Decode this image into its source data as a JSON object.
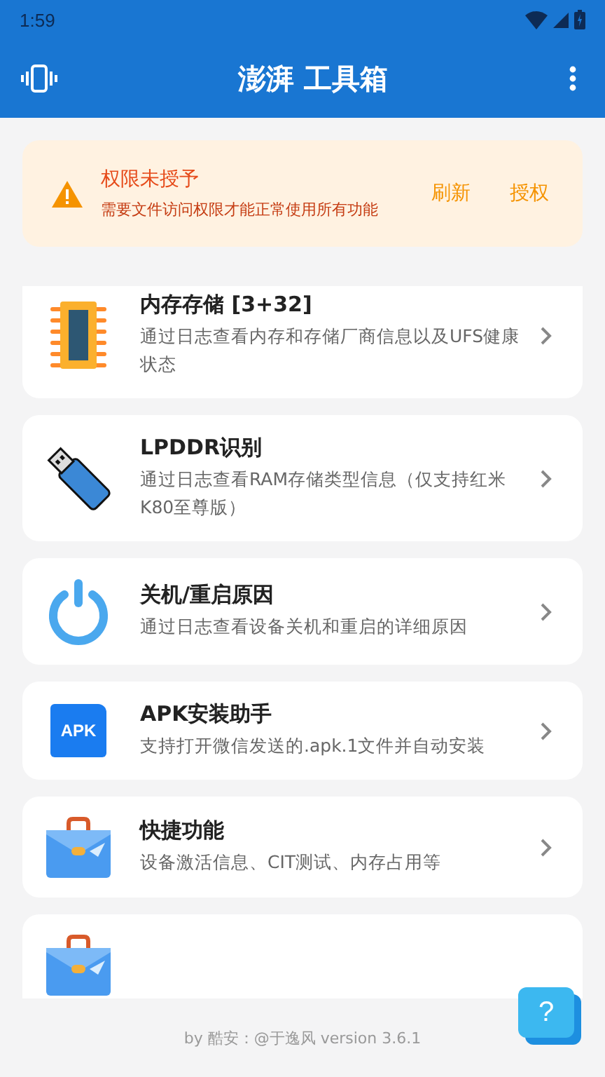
{
  "status_bar": {
    "time": "1:59"
  },
  "app_bar": {
    "title": "澎湃 工具箱"
  },
  "permission_banner": {
    "title": "权限未授予",
    "message": "需要文件访问权限才能正常使用所有功能",
    "actions": [
      "刷新",
      "授权"
    ]
  },
  "tools": [
    {
      "kind": "ram",
      "title": "内存存储 [3+32]",
      "description": "通过日志查看内存和存储厂商信息以及UFS健康状态"
    },
    {
      "kind": "usb",
      "title": "LPDDR识别",
      "description": "通过日志查看RAM存储类型信息（仅支持红米K80至尊版）"
    },
    {
      "kind": "power",
      "title": "关机/重启原因",
      "description": "通过日志查看设备关机和重启的详细原因"
    },
    {
      "kind": "apk",
      "title": "APK安装助手",
      "description": "支持打开微信发送的.apk.1文件并自动安装",
      "icon_text": "APK"
    },
    {
      "kind": "briefcase",
      "title": "快捷功能",
      "description": "设备激活信息、CIT测试、内存占用等"
    },
    {
      "kind": "briefcase"
    }
  ],
  "footer": "by 酷安：@于逸风 version 3.6.1",
  "help_button": {
    "label": "?"
  }
}
